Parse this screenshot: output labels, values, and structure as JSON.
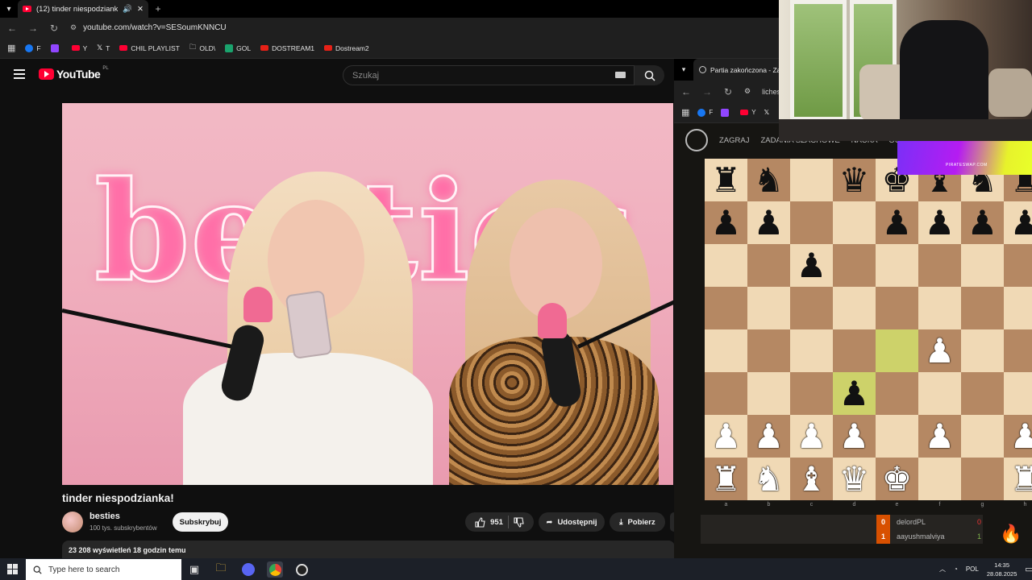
{
  "browser_left": {
    "tab_title": "(12) tinder niespodzianka! -",
    "url": "youtube.com/watch?v=SESoumKNNCU",
    "bookmarks": [
      {
        "label": "F",
        "color": "#1877f2"
      },
      {
        "label": "",
        "color": "#9146ff"
      },
      {
        "label": "Y",
        "color": "#ff0033"
      },
      {
        "label": "T",
        "color": "#000000"
      },
      {
        "label": "CHIL PLAYLIST",
        "color": "#ff0033"
      },
      {
        "label": "OLD\\",
        "color": "#777777"
      },
      {
        "label": "GOL",
        "color": "#1aa36d"
      },
      {
        "label": "DOSTREAM1",
        "color": "#e62117"
      },
      {
        "label": "Dostream2",
        "color": "#e62117"
      }
    ]
  },
  "youtube": {
    "logo_text": "YouTube",
    "region": "PL",
    "search_placeholder": "Szukaj",
    "video": {
      "neon_text": "besties",
      "title": "tinder niespodzianka!",
      "channel": "besties",
      "subscribers": "100 tys. subskrybentów",
      "subscribe_label": "Subskrybuj",
      "likes": "951",
      "share_label": "Udostępnij",
      "download_label": "Pobierz",
      "views_line": "23 208 wyświetleń  18 godzin temu"
    }
  },
  "browser_right": {
    "tab_title": "Partia zakończona - Zag",
    "url_partial": "liches",
    "bookmarks": [
      "F",
      "",
      "Y",
      ""
    ]
  },
  "lichess": {
    "nav": [
      "ZAGRAJ",
      "ZADANIA SZACHOWE",
      "NAUKA",
      "OGL"
    ],
    "files": [
      "a",
      "b",
      "c",
      "d",
      "e",
      "f",
      "g",
      "h"
    ],
    "board": [
      [
        "r",
        "n",
        "",
        "q",
        "k",
        "b",
        "n",
        "r"
      ],
      [
        "p",
        "p",
        "",
        "",
        "p",
        "p",
        "p",
        "p"
      ],
      [
        "",
        "",
        "p",
        "",
        "",
        "",
        "",
        ""
      ],
      [
        "",
        "",
        "",
        "",
        "",
        "",
        "",
        ""
      ],
      [
        "",
        "",
        "",
        "",
        "",
        "P",
        "",
        ""
      ],
      [
        "",
        "",
        "",
        "p",
        "",
        "",
        "",
        ""
      ],
      [
        "P",
        "P",
        "P",
        "P",
        "",
        "P",
        "",
        "P"
      ],
      [
        "R",
        "N",
        "B",
        "Q",
        "K",
        "",
        "",
        "R"
      ]
    ],
    "highlights": [
      "e4",
      "d3"
    ],
    "players": [
      {
        "name": "delordPL",
        "left_score": "0",
        "right_score": "0"
      },
      {
        "name": "aayushmalviya",
        "left_score": "1",
        "right_score": "1"
      }
    ],
    "colors": {
      "light": "#f0d9b5",
      "dark": "#b58863",
      "score": "#d85000"
    }
  },
  "overlay": {
    "ad_brand": "PIRATESWAP.COM"
  },
  "taskbar": {
    "search_placeholder": "Type here to search",
    "language": "POL",
    "time": "14:35",
    "date": "28.08.2025"
  }
}
